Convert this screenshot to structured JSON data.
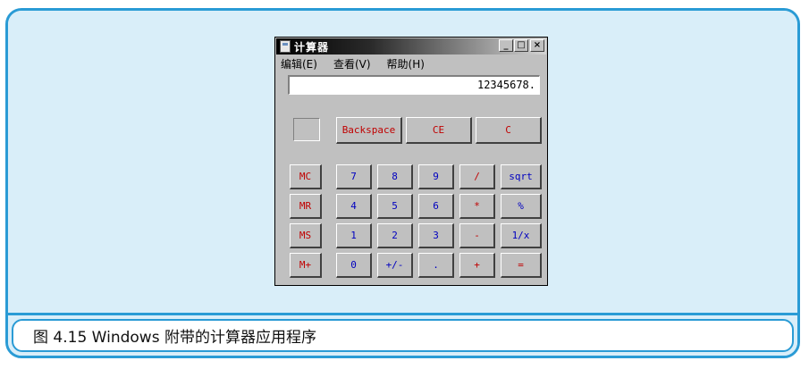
{
  "calculator": {
    "title": "计算器",
    "window_buttons": {
      "minimize": "_",
      "maximize": "□",
      "close": "×"
    },
    "menu": [
      {
        "label": "编辑(E)"
      },
      {
        "label": "查看(V)"
      },
      {
        "label": "帮助(H)"
      }
    ],
    "display_value": "12345678.",
    "top_keys": {
      "backspace": "Backspace",
      "ce": "CE",
      "c": "C"
    },
    "memory_keys": [
      "MC",
      "MR",
      "MS",
      "M+"
    ],
    "rows": [
      [
        "7",
        "8",
        "9",
        "/",
        "sqrt"
      ],
      [
        "4",
        "5",
        "6",
        "*",
        "%"
      ],
      [
        "1",
        "2",
        "3",
        "-",
        "1/x"
      ],
      [
        "0",
        "+/-",
        ".",
        "+",
        "="
      ]
    ]
  },
  "caption": {
    "text": "图 4.15   Windows 附带的计算器应用程序"
  },
  "colors": {
    "frame_border": "#2a9bd5",
    "frame_fill": "#d9eef9",
    "window_face": "#c0c0c0"
  }
}
